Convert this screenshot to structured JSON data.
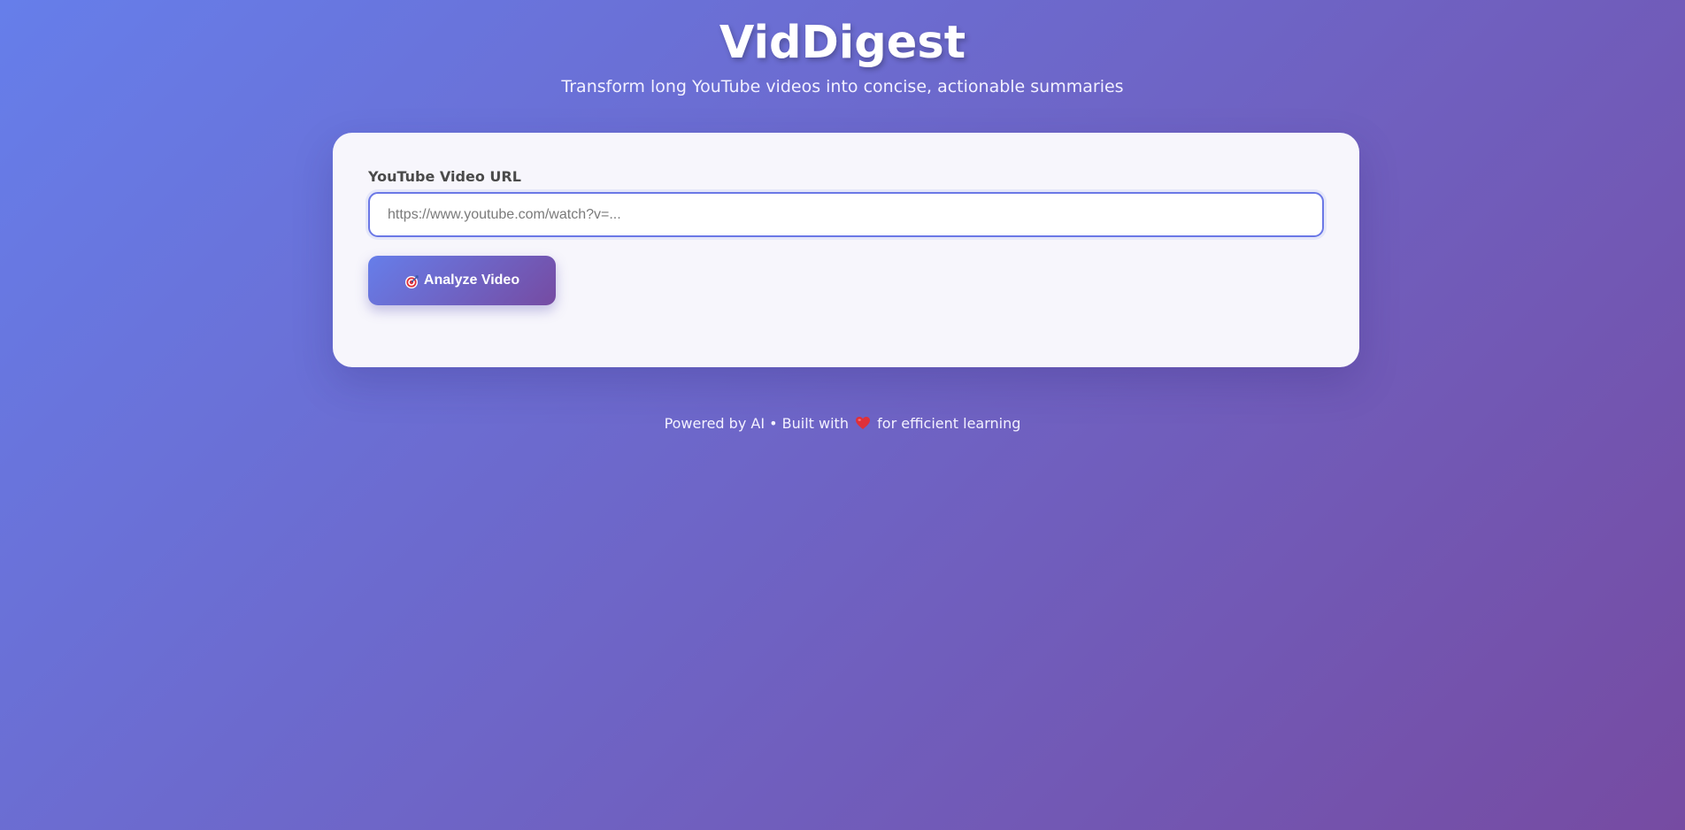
{
  "header": {
    "title": "VidDigest",
    "subtitle": "Transform long YouTube videos into concise, actionable summaries"
  },
  "form": {
    "url_label": "YouTube Video URL",
    "url_value": "",
    "url_placeholder": "https://www.youtube.com/watch?v=...",
    "button_icon": "target-icon",
    "button_label": "Analyze Video"
  },
  "footer": {
    "text_before": "Powered by AI • Built with",
    "icon": "heart-icon",
    "text_after": "for efficient learning"
  },
  "colors": {
    "gradient_start": "#667eea",
    "gradient_end": "#764ba2",
    "card_background": "#f7f6fc",
    "heart": "#e0303a"
  }
}
